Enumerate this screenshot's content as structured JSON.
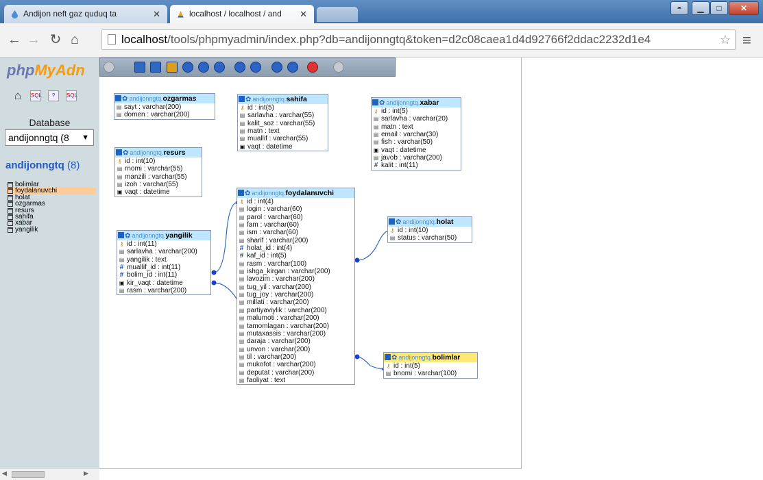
{
  "browser": {
    "tabs": [
      {
        "title": "Andijon neft gaz quduq ta",
        "active": false
      },
      {
        "title": "localhost / localhost / and",
        "active": true
      }
    ],
    "url_host": "localhost",
    "url_rest": "/tools/phpmyadmin/index.php?db=andijonngtq&token=d2c08caea1d4d92766f2ddac2232d1e4"
  },
  "sidebar": {
    "logo_a": "php",
    "logo_b": "MyAdn",
    "database_label": "Database",
    "database_select": "andijonngtq (8",
    "db_name": "andijonngtq",
    "db_count": "(8)",
    "tables": [
      "bolimlar",
      "foydalanuvchi",
      "holat",
      "ozgarmas",
      "resurs",
      "sahifa",
      "xabar",
      "yangilik"
    ],
    "selected_table": "foydalanuvchi"
  },
  "designer": {
    "db_prefix": "andijonngtq.",
    "tables": {
      "ozgarmas": [
        "sayt : varchar(200)",
        "domen : varchar(200)"
      ],
      "sahifa": [
        "id : int(5)",
        "sarlavha : varchar(55)",
        "kalit_soz : varchar(55)",
        "matn : text",
        "muallif : varchar(55)",
        "vaqt : datetime"
      ],
      "xabar": [
        "id : int(5)",
        "sarlavha : varchar(20)",
        "matn : text",
        "email : varchar(30)",
        "fish : varchar(50)",
        "vaqt : datetime",
        "javob : varchar(200)",
        "kalit : int(11)"
      ],
      "resurs": [
        "id : int(10)",
        "rnomi : varchar(55)",
        "manzili : varchar(55)",
        "izoh : varchar(55)",
        "vaqt : datetime"
      ],
      "foydalanuvchi": [
        "id : int(4)",
        "login : varchar(60)",
        "parol : varchar(60)",
        "fam : varchar(60)",
        "ism : varchar(60)",
        "sharif : varchar(200)",
        "holat_id : int(4)",
        "kaf_id : int(5)",
        "rasm : varchar(100)",
        "ishga_kirgan : varchar(200)",
        "lavozim : varchar(200)",
        "tug_yil : varchar(200)",
        "tug_joy : varchar(200)",
        "millati : varchar(200)",
        "partiyaviylik : varchar(200)",
        "malumoti : varchar(200)",
        "tamomlagan : varchar(200)",
        "mutaxassis : varchar(200)",
        "daraja : varchar(200)",
        "unvon : varchar(200)",
        "til : varchar(200)",
        "mukofot : varchar(200)",
        "deputat : varchar(200)",
        "faoliyat : text"
      ],
      "holat": [
        "id : int(10)",
        "status : varchar(50)"
      ],
      "yangilik": [
        "id : int(11)",
        "sarlavha : varchar(200)",
        "yangilik : text",
        "muallif_id : int(11)",
        "bolim_id : int(11)",
        "kir_vaqt : datetime",
        "rasm : varchar(200)"
      ],
      "bolimlar": [
        "id : int(5)",
        "bnomi : varchar(100)"
      ]
    }
  }
}
